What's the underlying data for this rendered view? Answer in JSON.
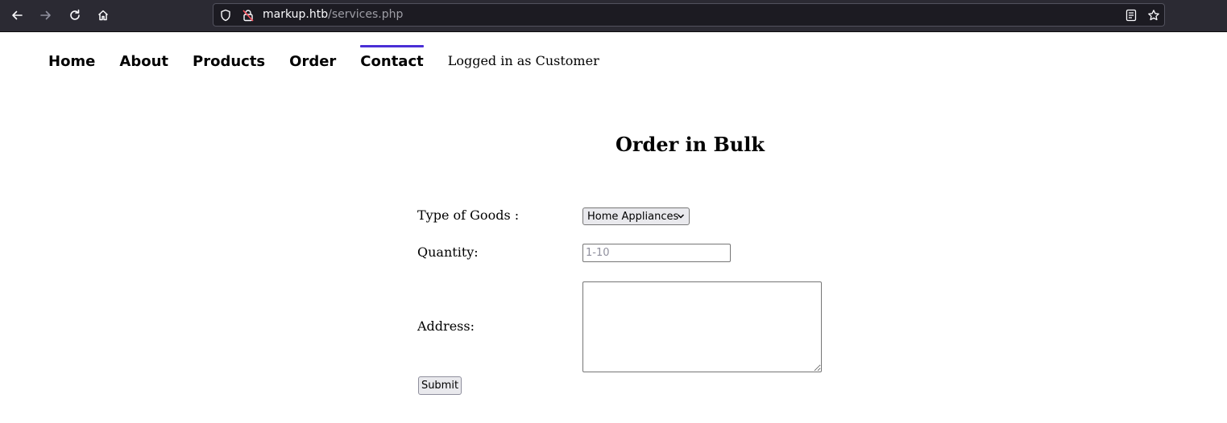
{
  "browser": {
    "url_host": "markup.htb",
    "url_path": "/services.php"
  },
  "nav": {
    "items": [
      {
        "label": "Home"
      },
      {
        "label": "About"
      },
      {
        "label": "Products"
      },
      {
        "label": "Order"
      },
      {
        "label": "Contact",
        "active": true
      }
    ],
    "status": "Logged in as Customer",
    "accent_color": "#4a2fd6"
  },
  "form": {
    "title": "Order in Bulk",
    "type_label": "Type of Goods :",
    "type_value": "Home Appliances",
    "quantity_label": "Quantity:",
    "quantity_placeholder": "1-10",
    "address_label": "Address:",
    "submit_label": "Submit"
  }
}
